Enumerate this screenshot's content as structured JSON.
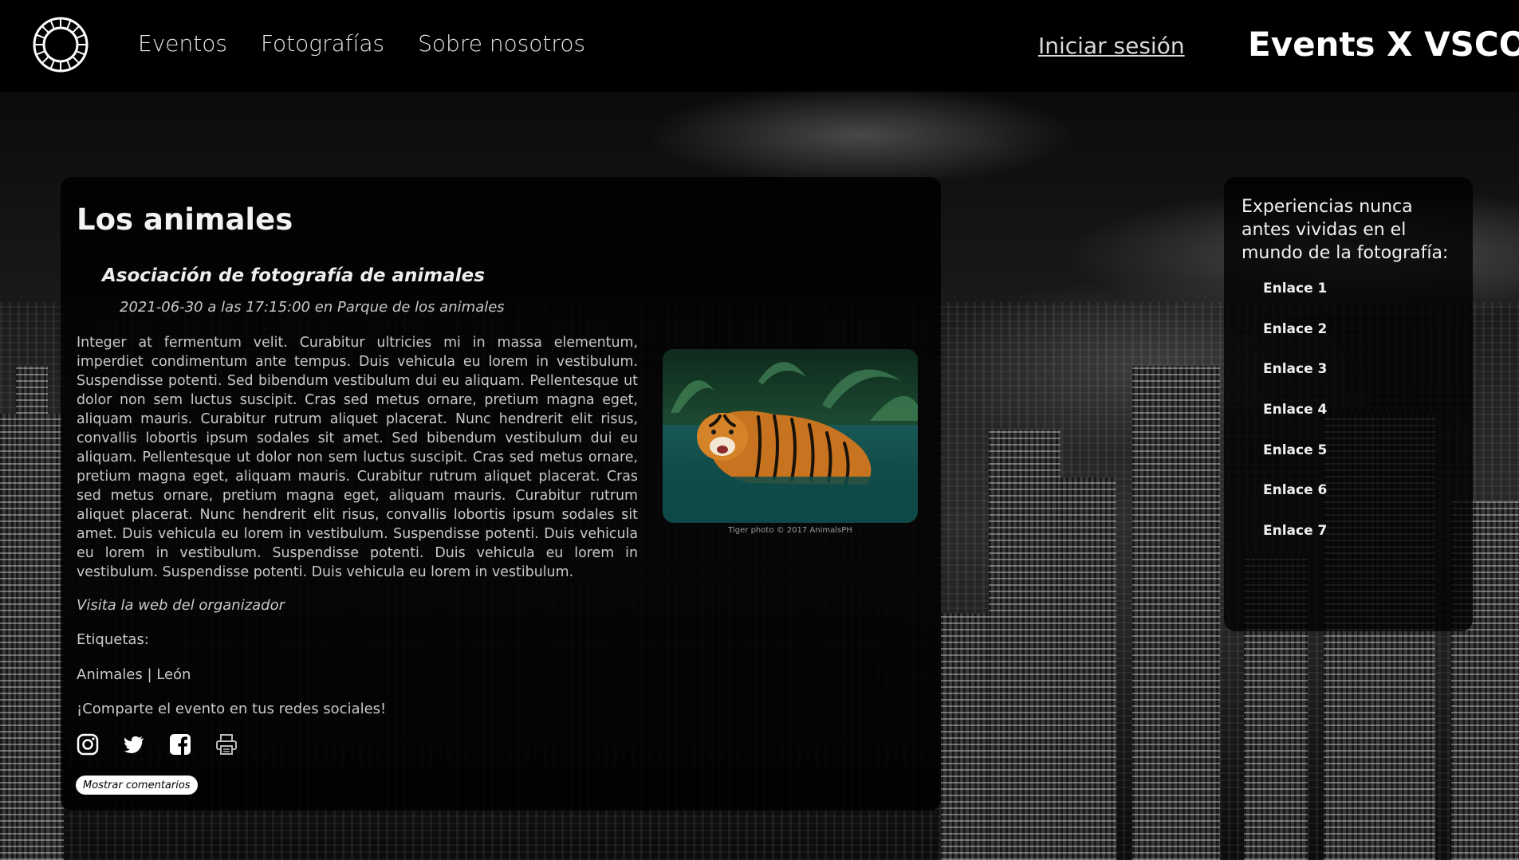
{
  "nav": {
    "items": [
      "Eventos",
      "Fotografías",
      "Sobre nosotros"
    ],
    "login": "Iniciar sesión",
    "brand": "Events X VSCO"
  },
  "event": {
    "title": "Los animales",
    "subtitle": "Asociación de fotografía de animales",
    "datetime": "2021-06-30 a las 17:15:00 en Parque de los animales",
    "description": "Integer at fermentum velit. Curabitur ultricies mi in massa elementum, imperdiet condimentum ante tempus. Duis vehicula eu lorem in vestibulum. Suspendisse potenti. Sed bibendum vestibulum dui eu aliquam. Pellentesque ut dolor non sem luctus suscipit. Cras sed metus ornare, pretium magna eget, aliquam mauris. Curabitur rutrum aliquet placerat. Nunc hendrerit elit risus, convallis lobortis ipsum sodales sit amet. Sed bibendum vestibulum dui eu aliquam. Pellentesque ut dolor non sem luctus suscipit. Cras sed metus ornare, pretium magna eget, aliquam mauris. Curabitur rutrum aliquet placerat. Cras sed metus ornare, pretium magna eget, aliquam mauris. Curabitur rutrum aliquet placerat. Nunc hendrerit elit risus, convallis lobortis ipsum sodales sit amet. Duis vehicula eu lorem in vestibulum. Suspendisse potenti. Duis vehicula eu lorem in vestibulum. Suspendisse potenti. Duis vehicula eu lorem in vestibulum. Suspendisse potenti. Duis vehicula eu lorem in vestibulum.",
    "photo_caption": "Tiger photo © 2017 AnimalsPH",
    "organizer_link": "Visita la web del organizador",
    "tags_label": "Etiquetas:",
    "tags": "Animales | León",
    "share_text": "¡Comparte el evento en tus redes sociales!",
    "social_icons": [
      "instagram-icon",
      "twitter-icon",
      "facebook-icon",
      "print-icon"
    ],
    "comments_button": "Mostrar comentarios"
  },
  "sidebar": {
    "title": "Experiencias nunca antes vividas en el mundo de la fotografía:",
    "links": [
      "Enlace 1",
      "Enlace 2",
      "Enlace 3",
      "Enlace 4",
      "Enlace 5",
      "Enlace 6",
      "Enlace 7"
    ]
  },
  "colors": {
    "background": "#000000",
    "text": "#c9c9c9",
    "heading": "#f3f3f3",
    "button_bg": "#ffffff"
  }
}
